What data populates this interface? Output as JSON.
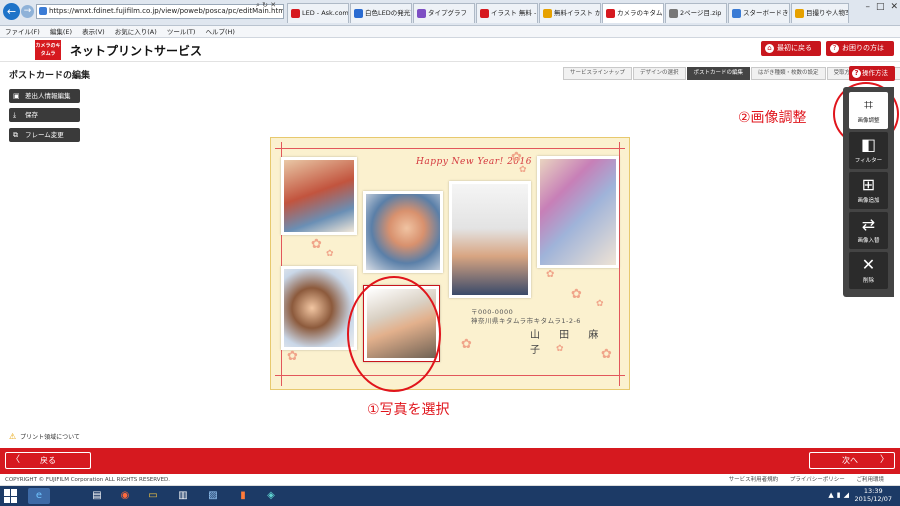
{
  "browser": {
    "url": "https://wnxt.fdinet.fujifilm.co.jp/view/poweb/posca/pc/editMain.html",
    "tabs": [
      {
        "label": "LED - Ask.com ...",
        "color": "#d6191f"
      },
      {
        "label": "白色LEDの発光方...",
        "color": "#2a6bd1"
      },
      {
        "label": "タイプグラフ",
        "color": "#7d4fc4"
      },
      {
        "label": "イラスト 無料 - A...",
        "color": "#d6191f"
      },
      {
        "label": "無料イラスト かわい...",
        "color": "#e6a100"
      },
      {
        "label": "カメラのキタムラ...",
        "color": "#d6191f",
        "active": true
      },
      {
        "label": "2ページ目.zip",
        "color": "#777777"
      },
      {
        "label": "スターボードきまぐれ...",
        "color": "#3a7bd5"
      },
      {
        "label": "目撮りや人物写真...",
        "color": "#e6a100"
      }
    ],
    "menu": [
      "ファイル(F)",
      "編集(E)",
      "表示(V)",
      "お気に入り(A)",
      "ツール(T)",
      "ヘルプ(H)"
    ]
  },
  "header": {
    "logo": "カメラのキタムラ",
    "title": "ネットプリントサービス",
    "back_label": "最初に戻る",
    "help_label": "お困りの方はこちら"
  },
  "editor": {
    "page_title": "ポストカードの編集",
    "steps": [
      "サービスラインナップ",
      "デザインの選択",
      "ポストカードの編集",
      "はがき種類・枚数の設定",
      "受取方法選択〜注文完了"
    ],
    "active_step": 2,
    "ops_label": "操作方法",
    "left_buttons": [
      "差出人情報編集",
      "保存",
      "フレーム変更"
    ]
  },
  "postcard": {
    "greeting": "Happy New Year! 2016",
    "zip": "〒000-0000",
    "address": "神奈川県キタムラ市キタムラ1-2-6",
    "name": "山 田 麻 子"
  },
  "annotations": {
    "select_photo": "①写真を選択",
    "image_adjust": "②画像調整"
  },
  "toolbar": {
    "tools": [
      "画像調整",
      "フィルター",
      "画像追加",
      "画像入替",
      "削除"
    ]
  },
  "print_note": "プリント領域について",
  "bottom": {
    "prev_label": "戻る",
    "next_label": "次へ"
  },
  "footer": {
    "copyright": "COPYRIGHT © FUJIFILM Corporation ALL RIGHTS RESERVED.",
    "links": [
      "サービス利用者規約",
      "プライバシーポリシー",
      "ご利用環境"
    ]
  },
  "taskbar": {
    "time": "13:39",
    "date": "2015/12/07"
  }
}
